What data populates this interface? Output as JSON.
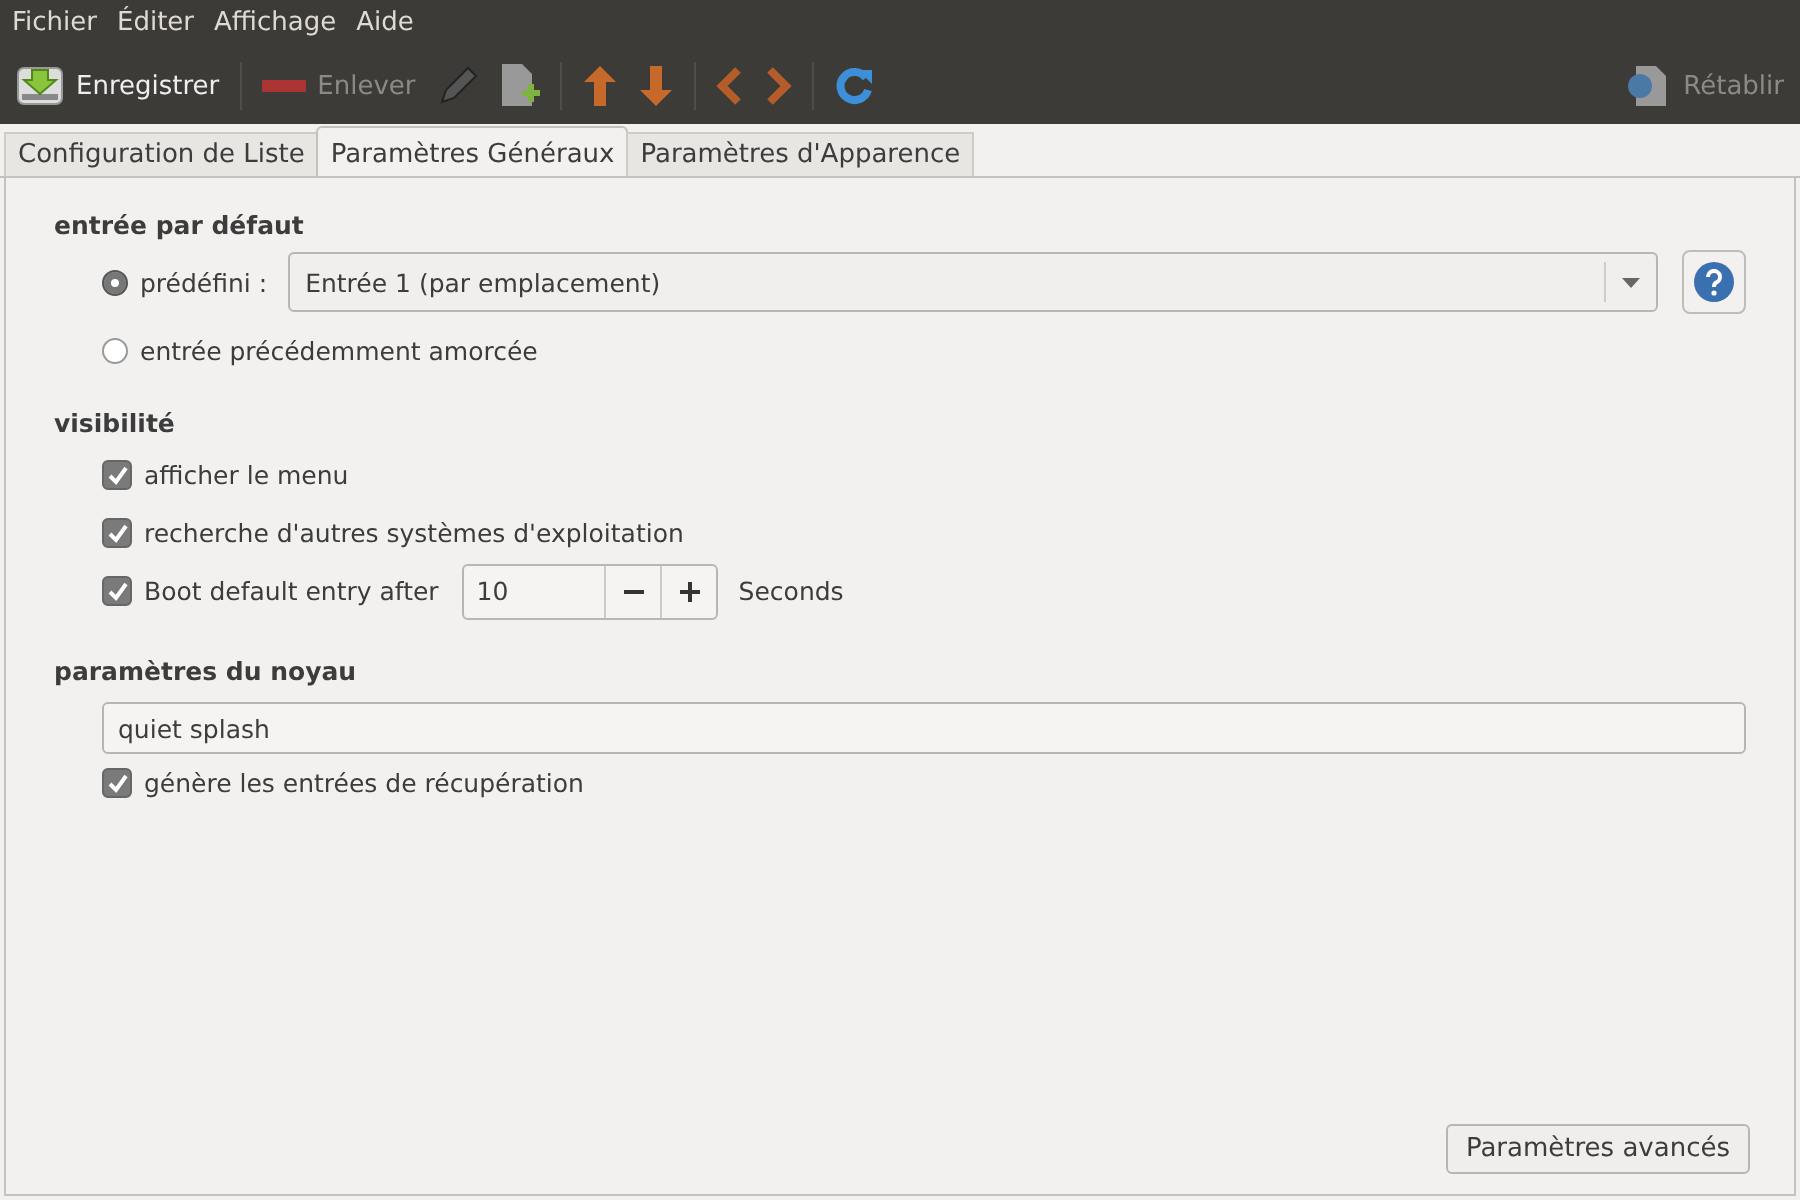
{
  "menu": [
    "Fichier",
    "Éditer",
    "Affichage",
    "Aide"
  ],
  "toolbar": {
    "save": {
      "label": "Enregistrer",
      "disabled": false
    },
    "remove": {
      "label": "Enlever",
      "disabled": true
    },
    "restore": {
      "label": "Rétablir",
      "disabled": true
    }
  },
  "tabs": [
    {
      "label": "Configuration de Liste",
      "selected": false
    },
    {
      "label": "Paramètres Généraux",
      "selected": true
    },
    {
      "label": "Paramètres d'Apparence",
      "selected": false
    }
  ],
  "default_entry": {
    "heading": "entrée par défaut",
    "options": [
      {
        "label": "prédéfini :",
        "selected": true
      },
      {
        "label": "entrée précédemment amorcée",
        "selected": false
      }
    ],
    "dropdown": "Entrée 1 (par emplacement)"
  },
  "visibility": {
    "heading": "visibilité",
    "checkboxes": [
      {
        "label": "afficher le menu",
        "checked": true
      },
      {
        "label": "recherche d'autres systèmes d'exploitation",
        "checked": true
      },
      {
        "label": "Boot default entry after",
        "checked": true
      }
    ],
    "timeout": "10",
    "timeout_unit": "Seconds"
  },
  "kernel": {
    "heading": "paramètres du noyau",
    "value": "quiet splash",
    "recovery": {
      "label": "génère les entrées de récupération",
      "checked": true
    }
  },
  "advanced_button": "Paramètres avancés"
}
